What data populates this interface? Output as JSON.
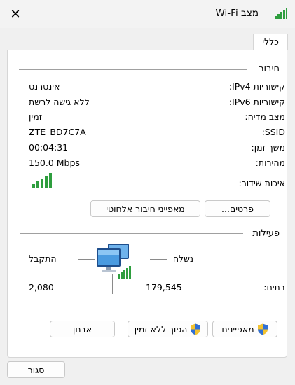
{
  "window": {
    "title": "מצב Wi-Fi",
    "close_glyph": "✕"
  },
  "tabs": [
    {
      "label": "כללי"
    }
  ],
  "connection": {
    "section_title": "חיבור",
    "rows": [
      {
        "label": "קישוריות IPv4:",
        "value": "אינטרנט"
      },
      {
        "label": "קישוריות IPv6:",
        "value": "ללא גישה לרשת"
      },
      {
        "label": "מצב מדיה:",
        "value": "זמין"
      },
      {
        "label": "SSID:",
        "value": "ZTE_BD7C7A"
      },
      {
        "label": "משך זמן:",
        "value": "00:04:31"
      },
      {
        "label": "מהירות:",
        "value": "150.0 Mbps"
      }
    ],
    "signal_label": "איכות שידור:",
    "signal_bars": 5,
    "signal_bars_max": 5,
    "details_button": "פרטים...",
    "wireless_props_button": "מאפייני חיבור אלחוטי"
  },
  "activity": {
    "section_title": "פעילות",
    "sent_label": "נשלח",
    "received_label": "התקבל",
    "bytes_label": "בתים:",
    "bytes_sent": "179,545",
    "bytes_received": "2,080"
  },
  "buttons": {
    "properties": "מאפיינים",
    "disable": "הפוך ללא זמין",
    "diagnose": "אבחן",
    "close": "סגור"
  },
  "colors": {
    "signal_green": "#2e9e3e",
    "shield_blue": "#2f6fd6",
    "shield_yellow": "#f2c230"
  },
  "icons": {
    "title": "wifi-signal-icon",
    "network": "network-computers-icon",
    "shield": "uac-shield-icon"
  }
}
